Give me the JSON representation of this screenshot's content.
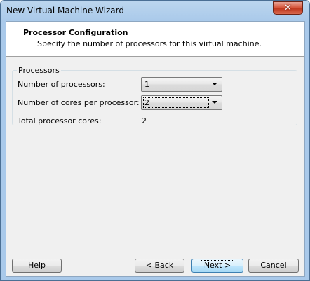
{
  "window": {
    "title": "New Virtual Machine Wizard",
    "close_glyph": "✕"
  },
  "header": {
    "title": "Processor Configuration",
    "subtitle": "Specify the number of processors for this virtual machine."
  },
  "processors_group": {
    "label": "Processors",
    "num_processors_label": "Number of processors:",
    "num_processors_value": "1",
    "cores_per_processor_label": "Number of cores per processor:",
    "cores_per_processor_value": "2",
    "total_cores_label": "Total processor cores:",
    "total_cores_value": "2"
  },
  "buttons": {
    "help": "Help",
    "back": "< Back",
    "next": "Next >",
    "cancel": "Cancel"
  },
  "icons": {
    "close": "close-icon",
    "dropdown": "chevron-down-icon"
  },
  "colors": {
    "titlebar": "#a9c9ea",
    "close_button": "#c0391f",
    "next_button_border": "#3c7fb1"
  }
}
